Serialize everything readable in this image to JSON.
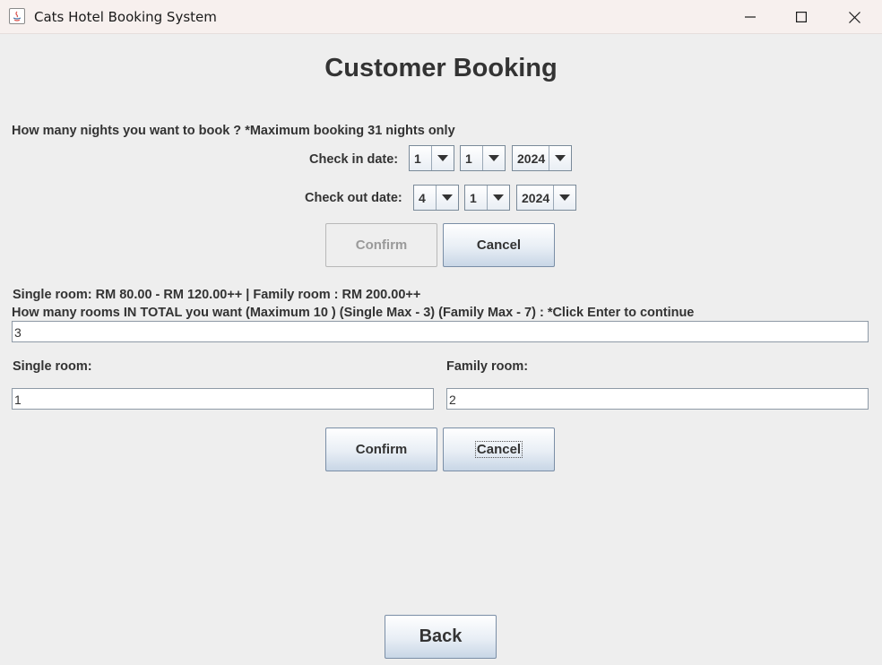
{
  "window": {
    "title": "Cats Hotel Booking System"
  },
  "heading": "Customer Booking",
  "nights": {
    "prompt": "How many nights you want to book ?  *Maximum booking 31 nights only",
    "checkin_label": "Check in date:",
    "checkin_day": "1",
    "checkin_month": "1",
    "checkin_year": "2024",
    "checkout_label": "Check out date:",
    "checkout_day": "4",
    "checkout_month": "1",
    "checkout_year": "2024",
    "confirm_label": "Confirm",
    "cancel_label": "Cancel"
  },
  "rooms": {
    "price_info": "Single room: RM 80.00 - RM 120.00++ | Family room : RM 200.00++",
    "total_prompt": "How many rooms IN TOTAL you want (Maximum 10 ) (Single Max - 3) (Family Max - 7) :  *Click Enter to continue",
    "total_value": "3",
    "single_label": "Single room:",
    "single_value": "1",
    "family_label": "Family room:",
    "family_value": "2",
    "confirm_label": "Confirm",
    "cancel_label": "Cancel"
  },
  "back_label": "Back",
  "colors": {
    "background": "#eeeeee",
    "titlebar": "#f7f0ee",
    "button_border": "#7a8ea6",
    "text": "#333333"
  },
  "icons": [
    "java-app-icon",
    "minimize-icon",
    "maximize-icon",
    "close-icon",
    "dropdown-arrow-icon"
  ]
}
